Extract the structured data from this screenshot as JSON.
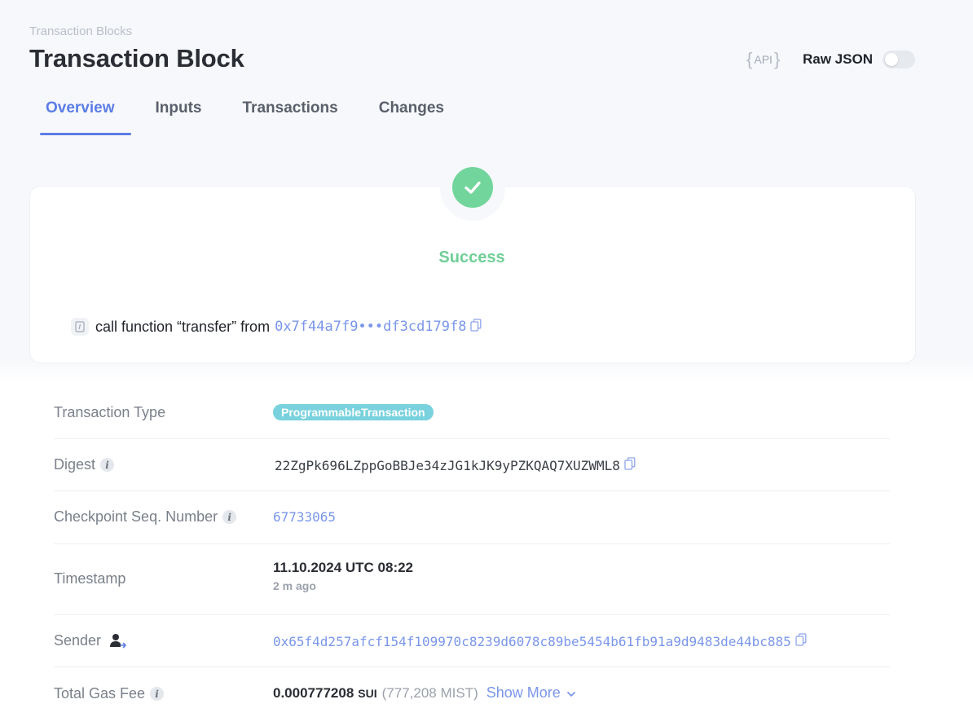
{
  "header": {
    "breadcrumb": "Transaction Blocks",
    "title": "Transaction Block",
    "api_label": "API",
    "raw_json_label": "Raw JSON"
  },
  "tabs": [
    {
      "label": "Overview",
      "active": true
    },
    {
      "label": "Inputs",
      "active": false
    },
    {
      "label": "Transactions",
      "active": false
    },
    {
      "label": "Changes",
      "active": false
    }
  ],
  "status": {
    "text": "Success",
    "call_text": "call function “transfer” from",
    "call_address": "0x7f44a7f9•••df3cd179f8"
  },
  "details": {
    "transaction_type": {
      "label": "Transaction Type",
      "value": "ProgrammableTransaction"
    },
    "digest": {
      "label": "Digest",
      "value": "22ZgPk696LZppGoBBJe34zJG1kJK9yPZKQAQ7XUZWML8"
    },
    "checkpoint": {
      "label": "Checkpoint Seq. Number",
      "value": "67733065"
    },
    "timestamp": {
      "label": "Timestamp",
      "value": "11.10.2024 UTC 08:22",
      "relative": "2 m ago"
    },
    "sender": {
      "label": "Sender",
      "value": "0x65f4d257afcf154f109970c8239d6078c89be5454b61fb91a9d9483de44bc885"
    },
    "gas_fee": {
      "label": "Total Gas Fee",
      "value": "0.000777208",
      "unit": "SUI",
      "mist": "(777,208 MIST)",
      "show_more": "Show More"
    }
  },
  "colors": {
    "accent": "#5b7de6",
    "success": "#72d69c",
    "link": "#7a96ea",
    "pill": "#79d2dd"
  }
}
